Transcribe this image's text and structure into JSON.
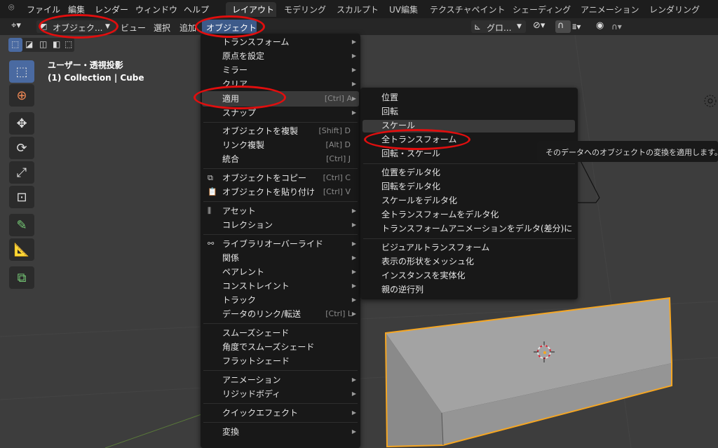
{
  "menubar": {
    "items": [
      "ファイル",
      "編集",
      "レンダー",
      "ウィンドウ",
      "ヘルプ"
    ]
  },
  "workspaces": [
    "レイアウト",
    "モデリング",
    "スカルプト",
    "UV編集",
    "テクスチャペイント",
    "シェーディング",
    "アニメーション",
    "レンダリング"
  ],
  "header": {
    "mode": "オブジェク...",
    "view": "ビュー",
    "select": "選択",
    "add": "追加",
    "object": "オブジェクト",
    "orientation": "グロ..."
  },
  "viewport": {
    "projection": "ユーザー・透視投影",
    "collection": "(1) Collection | Cube"
  },
  "object_menu": [
    {
      "label": "トランスフォーム",
      "submenu": true
    },
    {
      "label": "原点を設定",
      "submenu": true
    },
    {
      "label": "ミラー",
      "submenu": true
    },
    {
      "label": "クリア",
      "submenu": true
    },
    {
      "label": "適用",
      "shortcut": "[Ctrl] A",
      "submenu": true
    },
    {
      "label": "スナップ",
      "submenu": true
    },
    {
      "label": "オブジェクトを複製",
      "shortcut": "[Shift] D"
    },
    {
      "label": "リンク複製",
      "shortcut": "[Alt] D"
    },
    {
      "label": "統合",
      "shortcut": "[Ctrl] J"
    },
    {
      "label": "オブジェクトをコピー",
      "shortcut": "[Ctrl] C"
    },
    {
      "label": "オブジェクトを貼り付け",
      "shortcut": "[Ctrl] V"
    },
    {
      "label": "アセット",
      "submenu": true
    },
    {
      "label": "コレクション",
      "submenu": true
    },
    {
      "label": "ライブラリオーバーライド",
      "submenu": true
    },
    {
      "label": "関係",
      "submenu": true
    },
    {
      "label": "ペアレント",
      "submenu": true
    },
    {
      "label": "コンストレイント",
      "submenu": true
    },
    {
      "label": "トラック",
      "submenu": true
    },
    {
      "label": "データのリンク/転送",
      "shortcut": "[Ctrl] L"
    },
    {
      "label": "スムーズシェード"
    },
    {
      "label": "角度でスムーズシェード"
    },
    {
      "label": "フラットシェード"
    },
    {
      "label": "アニメーション",
      "submenu": true
    },
    {
      "label": "リジッドボディ",
      "submenu": true
    },
    {
      "label": "クイックエフェクト",
      "submenu": true
    },
    {
      "label": "変換",
      "submenu": true
    }
  ],
  "apply_submenu": [
    "位置",
    "回転",
    "スケール",
    "全トランスフォーム",
    "回転・スケール",
    "位置をデルタ化",
    "回転をデルタ化",
    "スケールをデルタ化",
    "全トランスフォームをデルタ化",
    "トランスフォームアニメーションをデルタ(差分)に",
    "ビジュアルトランスフォーム",
    "表示の形状をメッシュ化",
    "インスタンスを実体化",
    "親の逆行列"
  ],
  "tooltip": "そのデータへのオブジェクトの変換を適用します。",
  "colors": {
    "annotation": "#e00e0e",
    "selection": "#f5a623",
    "active_tool": "#4a6aa1"
  }
}
